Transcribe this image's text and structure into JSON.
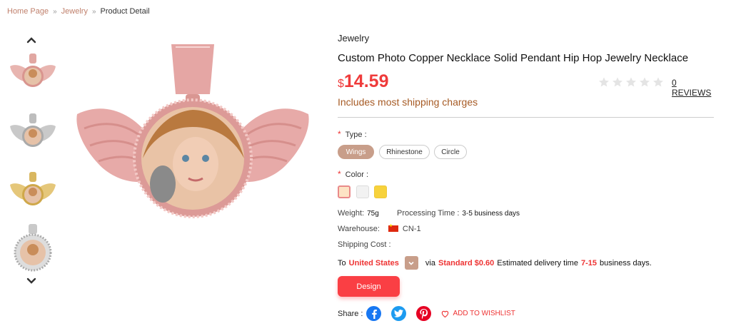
{
  "breadcrumb": {
    "home": "Home Page",
    "category": "Jewelry",
    "current": "Product Detail",
    "separator": "»"
  },
  "thumbnails": [
    {
      "name": "wings rose gold"
    },
    {
      "name": "wings silver"
    },
    {
      "name": "wings gold"
    },
    {
      "name": "circle rhinestone"
    }
  ],
  "product": {
    "category": "Jewelry",
    "title": "Custom Photo Copper Necklace Solid Pendant Hip Hop Jewelry Necklace",
    "currency": "$",
    "price": "14.59",
    "shipping_note": "Includes most shipping charges",
    "rating_stars": 0,
    "reviews_label": "0 REVIEWS"
  },
  "options": {
    "type_label": "Type :",
    "types": [
      "Wings",
      "Rhinestone",
      "Circle"
    ],
    "selected_type": "Wings",
    "color_label": "Color :",
    "colors": [
      "#fde3c4",
      "#f2f2f2",
      "#f7d23c"
    ],
    "required_mark": "*"
  },
  "specs": {
    "weight_label": "Weight:",
    "weight": "75g",
    "processing_label": "Processing Time :",
    "processing": "3-5 business days",
    "warehouse_label": "Warehouse:",
    "warehouse": "CN-1",
    "shipping_cost_label": "Shipping Cost :"
  },
  "shipping": {
    "to": "To",
    "country": "United States",
    "via": "via",
    "method": "Standard $0.60",
    "estimated": "Estimated delivery time",
    "days": "7-15",
    "days_suffix": "business days."
  },
  "actions": {
    "design_label": "Design",
    "share_label": "Share :",
    "wishlist_label": "ADD TO WISHLIST"
  },
  "colors": {
    "accent": "#fa3f44",
    "price_red": "#ef3b3b",
    "brand_tan": "#c89e8a",
    "shipping_note": "#a65a24",
    "facebook": "#1877f2",
    "twitter": "#1d9bf0",
    "pinterest": "#e60023"
  }
}
